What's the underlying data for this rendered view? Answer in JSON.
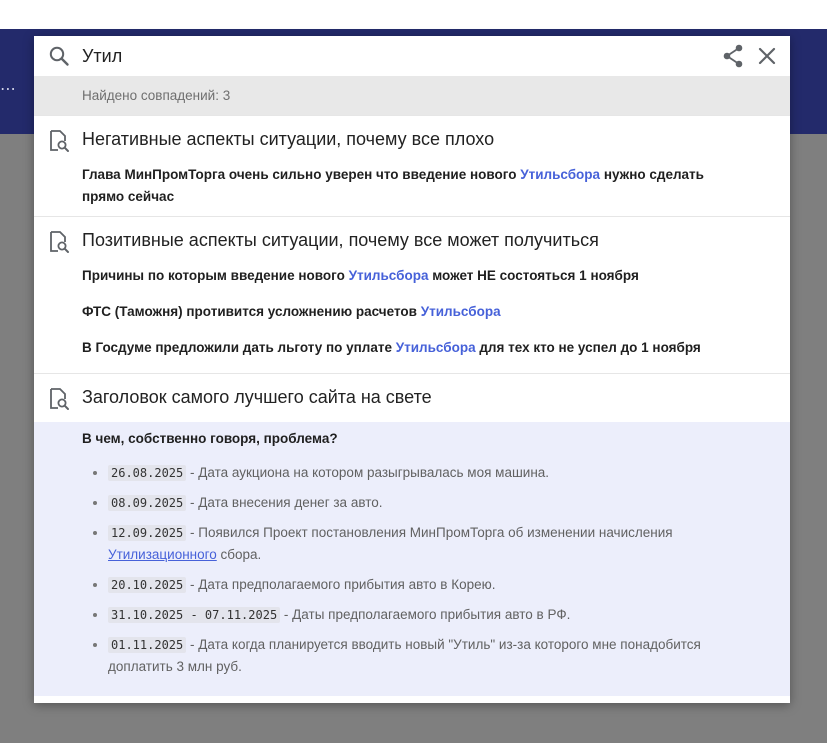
{
  "search": {
    "query": "Утил",
    "match_count": "Найдено совпадений: 3"
  },
  "groups": [
    {
      "title": "Негативные аспекты ситуации, почему все плохо",
      "hits": [
        {
          "before": "Глава МинПромТорга очень сильно уверен что введение нового ",
          "match": "Утильсбора",
          "after": " нужно сделать прямо сейчас"
        }
      ]
    },
    {
      "title": "Позитивные аспекты ситуации, почему все может получиться",
      "hits": [
        {
          "before": "Причины по которым введение нового ",
          "match": "Утильсбора",
          "after": " может НЕ состояться 1 ноября"
        },
        {
          "before": "ФТС (Таможня) противится усложнению расчетов ",
          "match": "Утильсбора",
          "after": ""
        },
        {
          "before": "В Госдуме предложили дать льготу по уплате ",
          "match": "Утильсбора",
          "after": " для тех кто не успел до 1 ноября"
        }
      ]
    },
    {
      "title": "Заголовок самого лучшего сайта на свете",
      "expanded": {
        "heading": "В чем, собственно говоря, проблема?",
        "items": [
          {
            "date": "26.08.2025",
            "text": " - Дата аукциона на котором разыгрывалась моя машина."
          },
          {
            "date": "08.09.2025",
            "text": " - Дата внесения денег за авто."
          },
          {
            "date": "12.09.2025",
            "text": " - Появился Проект постановления МинПромТорга об изменении начисления ",
            "link": "Утилизационного",
            "after": " сбора."
          },
          {
            "date": "20.10.2025",
            "text": " - Дата предполагаемого прибытия авто в Корею."
          },
          {
            "date": "31.10.2025 - 07.11.2025",
            "text": " - Даты предполагаемого прибытия авто в РФ."
          },
          {
            "date": "01.11.2025",
            "text": " - Дата когда планируется вводить новый \"Утиль\" из-за которого мне понадобится доплатить 3 млн руб."
          }
        ]
      }
    }
  ],
  "icons": {
    "search": "search-icon",
    "share": "share-icon",
    "close": "close-icon",
    "document_search": "document-search-icon"
  },
  "colors": {
    "header_navy": "#232a6b",
    "highlight": "#4661d9",
    "expanded_bg": "#eceefb"
  }
}
